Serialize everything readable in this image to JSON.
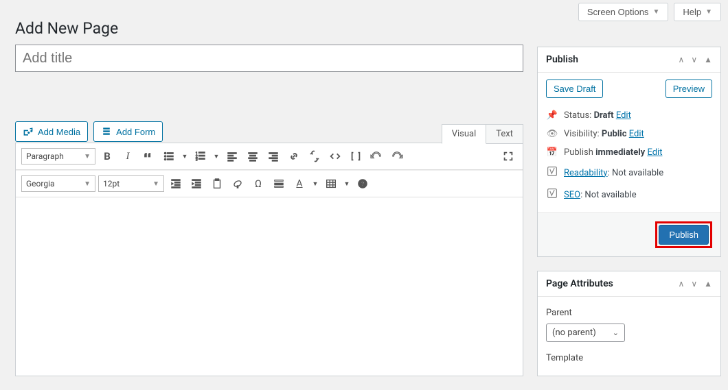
{
  "top": {
    "screen_options": "Screen Options",
    "help": "Help"
  },
  "page_title": "Add New Page",
  "title_placeholder": "Add title",
  "media": {
    "add_media": "Add Media",
    "add_form": "Add Form"
  },
  "tabs": {
    "visual": "Visual",
    "text": "Text"
  },
  "toolbar": {
    "format": "Paragraph",
    "font": "Georgia",
    "size": "12pt"
  },
  "publish_box": {
    "title": "Publish",
    "save_draft": "Save Draft",
    "preview": "Preview",
    "status_label": "Status:",
    "status_value": "Draft",
    "visibility_label": "Visibility:",
    "visibility_value": "Public",
    "publish_label": "Publish",
    "publish_value": "immediately",
    "edit": "Edit",
    "readability_label": "Readability",
    "seo_label": "SEO",
    "not_available": ": Not available",
    "publish_button": "Publish"
  },
  "attributes_box": {
    "title": "Page Attributes",
    "parent_label": "Parent",
    "parent_value": "(no parent)",
    "template_label": "Template"
  }
}
